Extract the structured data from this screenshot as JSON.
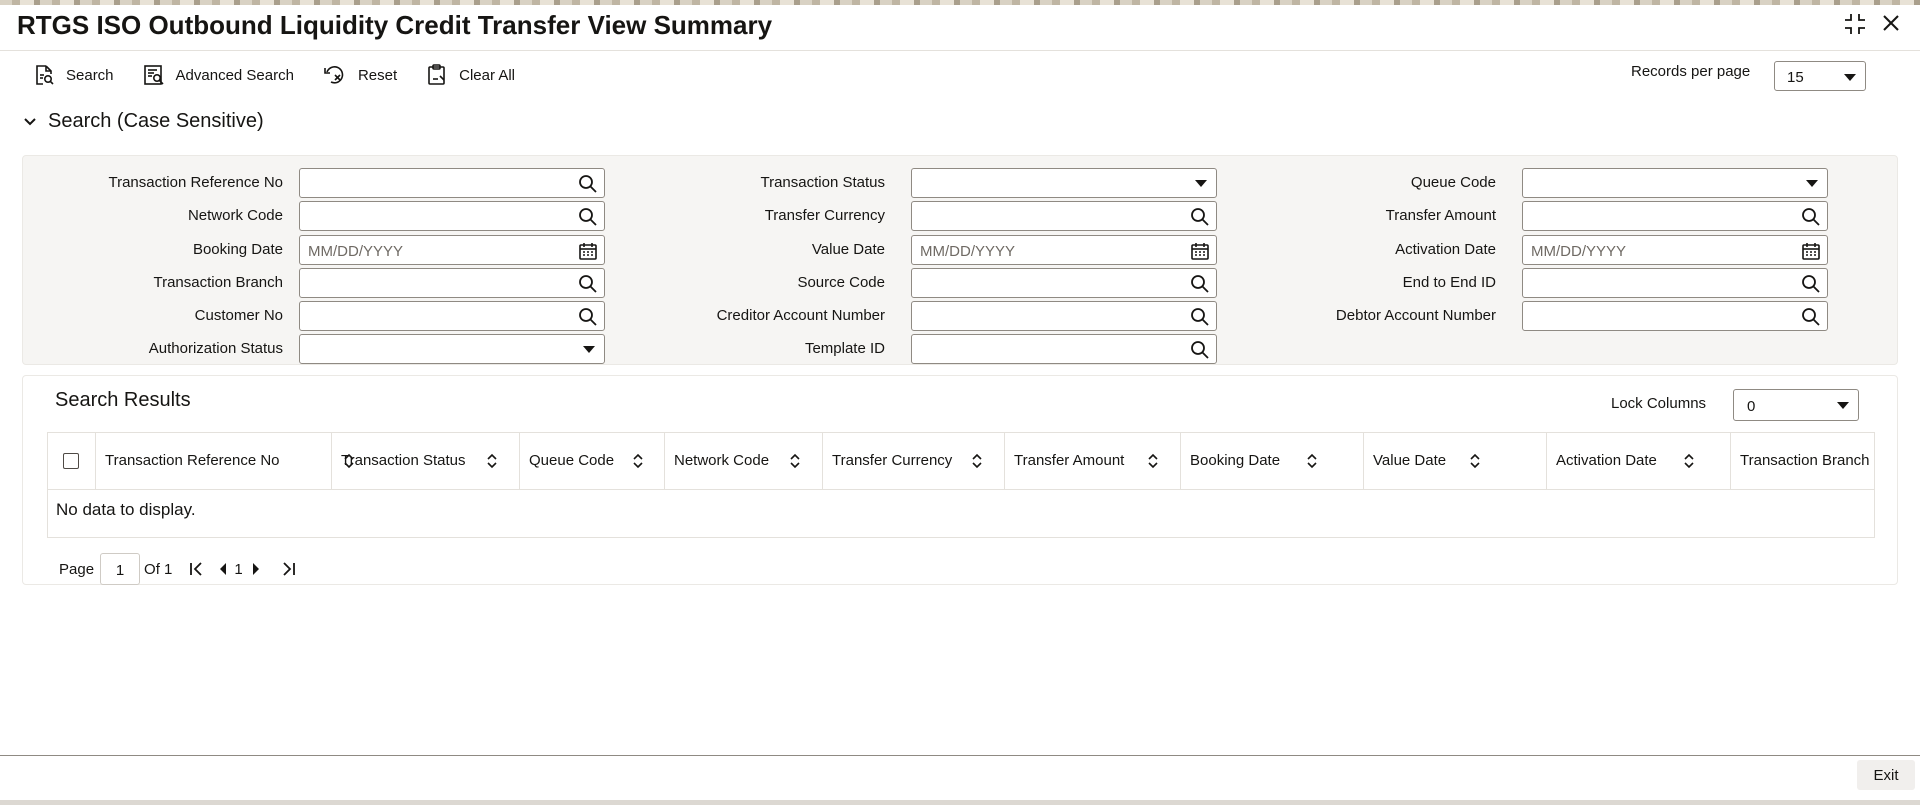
{
  "window": {
    "title": "RTGS ISO Outbound Liquidity Credit Transfer View Summary",
    "maximize_icon": "maximize-icon",
    "close_icon": "close-icon"
  },
  "toolbar": {
    "search_label": "Search",
    "advanced_search_label": "Advanced Search",
    "reset_label": "Reset",
    "clear_all_label": "Clear All",
    "records_per_page_label": "Records per page",
    "records_per_page_value": "15"
  },
  "search_section": {
    "title": "Search (Case Sensitive)",
    "fields": {
      "transaction_reference_no": {
        "label": "Transaction Reference No",
        "value": "",
        "placeholder": ""
      },
      "network_code": {
        "label": "Network Code",
        "value": "",
        "placeholder": ""
      },
      "booking_date": {
        "label": "Booking Date",
        "value": "",
        "placeholder": "MM/DD/YYYY"
      },
      "transaction_branch": {
        "label": "Transaction Branch",
        "value": "",
        "placeholder": ""
      },
      "customer_no": {
        "label": "Customer No",
        "value": "",
        "placeholder": ""
      },
      "authorization_status": {
        "label": "Authorization Status",
        "value": ""
      },
      "transaction_status": {
        "label": "Transaction Status",
        "value": ""
      },
      "transfer_currency": {
        "label": "Transfer Currency",
        "value": "",
        "placeholder": ""
      },
      "value_date": {
        "label": "Value Date",
        "value": "",
        "placeholder": "MM/DD/YYYY"
      },
      "source_code": {
        "label": "Source Code",
        "value": "",
        "placeholder": ""
      },
      "creditor_account_number": {
        "label": "Creditor Account Number",
        "value": "",
        "placeholder": ""
      },
      "template_id": {
        "label": "Template ID",
        "value": "",
        "placeholder": ""
      },
      "queue_code": {
        "label": "Queue Code",
        "value": ""
      },
      "transfer_amount": {
        "label": "Transfer Amount",
        "value": "",
        "placeholder": ""
      },
      "activation_date": {
        "label": "Activation Date",
        "value": "",
        "placeholder": "MM/DD/YYYY"
      },
      "end_to_end_id": {
        "label": "End to End ID",
        "value": "",
        "placeholder": ""
      },
      "debtor_account_number": {
        "label": "Debtor Account Number",
        "value": "",
        "placeholder": ""
      }
    }
  },
  "results": {
    "title": "Search Results",
    "lock_columns_label": "Lock Columns",
    "lock_columns_value": "0",
    "columns": [
      "Transaction Reference No",
      "Transaction Status",
      "Queue Code",
      "Network Code",
      "Transfer Currency",
      "Transfer Amount",
      "Booking Date",
      "Value Date",
      "Activation Date",
      "Transaction Branch"
    ],
    "empty_message": "No data to display.",
    "pager": {
      "page_label": "Page",
      "current_page": "1",
      "of_label": "Of 1",
      "page_number": "1"
    }
  },
  "footer": {
    "exit_label": "Exit"
  }
}
